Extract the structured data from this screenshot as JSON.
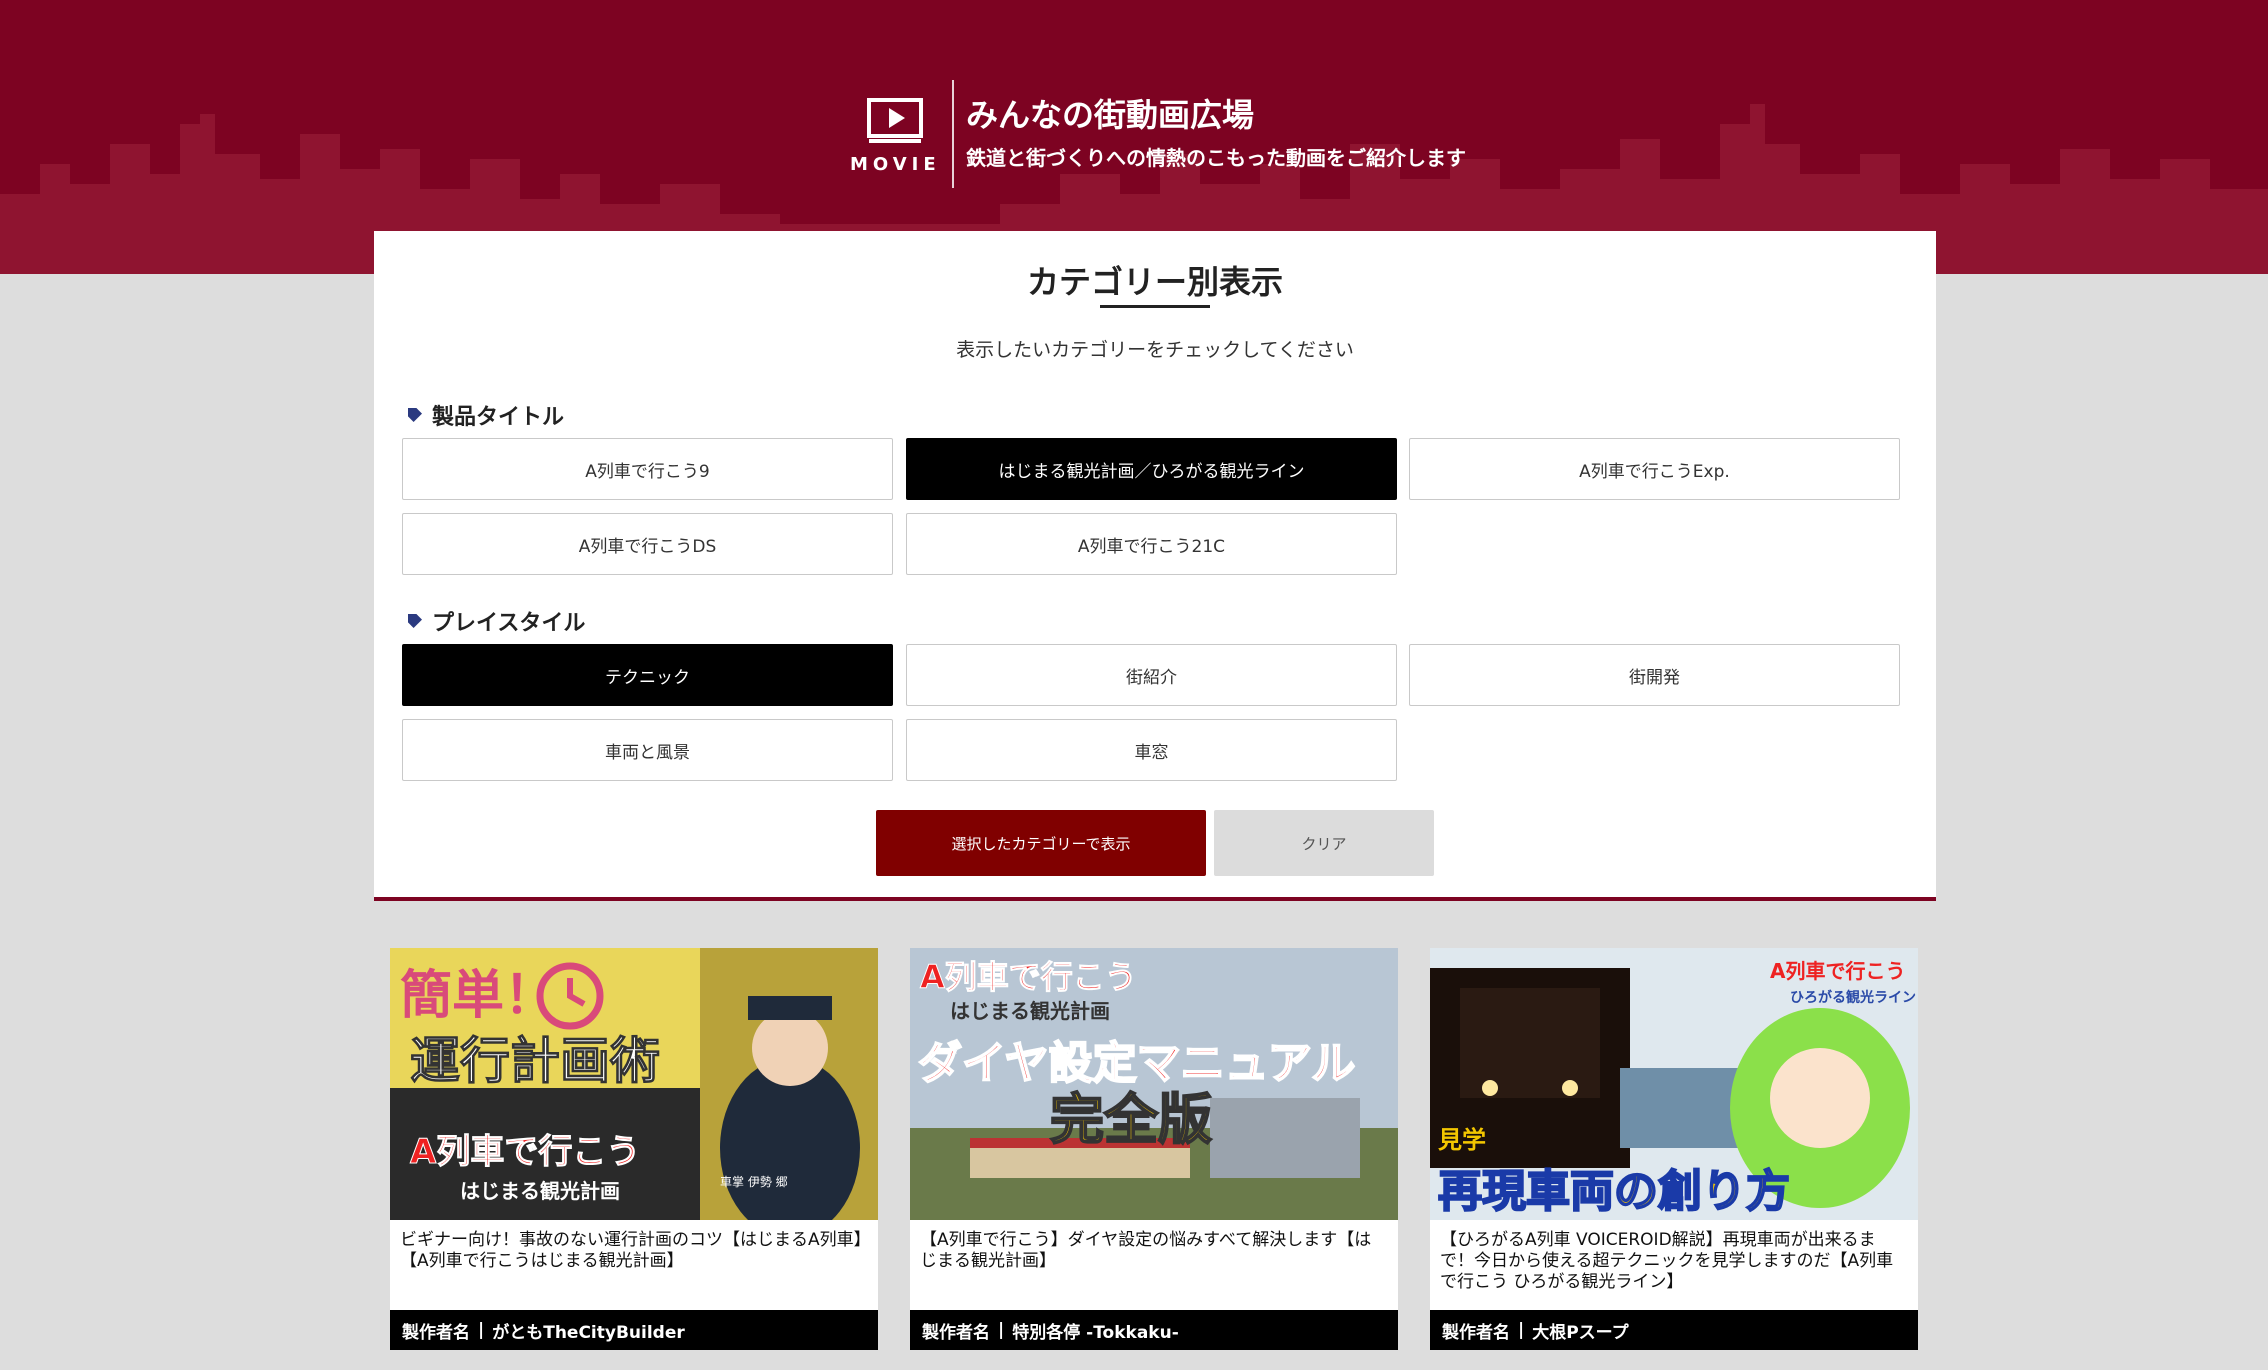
{
  "header": {
    "movie_label": "MOVIE",
    "title": "みんなの街動画広場",
    "subtitle": "鉄道と街づくりへの情熱のこもった動画をご紹介します",
    "icons": [
      "video-play-icon"
    ],
    "colors": {
      "brand": "#7d0322",
      "skyline": "#8f1430"
    }
  },
  "panel": {
    "title": "カテゴリー別表示",
    "subtitle": "表示したいカテゴリーをチェックしてください",
    "sections": [
      {
        "label": "製品タイトル",
        "options": [
          {
            "label": "A列車で行こう9",
            "selected": false
          },
          {
            "label": "はじまる観光計画／ひろがる観光ライン",
            "selected": true
          },
          {
            "label": "A列車で行こうExp.",
            "selected": false
          },
          {
            "label": "A列車で行こうDS",
            "selected": false
          },
          {
            "label": "A列車で行こう21C",
            "selected": false
          }
        ]
      },
      {
        "label": "プレイスタイル",
        "options": [
          {
            "label": "テクニック",
            "selected": true
          },
          {
            "label": "街紹介",
            "selected": false
          },
          {
            "label": "街開発",
            "selected": false
          },
          {
            "label": "車両と風景",
            "selected": false
          },
          {
            "label": "車窓",
            "selected": false
          }
        ]
      }
    ],
    "show_button": "選択したカテゴリーで表示",
    "clear_button": "クリア"
  },
  "cards": [
    {
      "thumb_texts": [
        "簡単！",
        "運行計画術",
        "A列車で行こう",
        "はじまる観光計画",
        "車掌 伊勢 郷"
      ],
      "title": "ビギナー向け！事故のない運行計画のコツ【はじまるA列車】【A列車で行こうはじまる観光計画】",
      "author_label": "製作者名",
      "author": "がともTheCityBuilder"
    },
    {
      "thumb_texts": [
        "A列車で行こう",
        "はじまる観光計画",
        "ダイヤ設定マニュアル",
        "完全版"
      ],
      "title": "【A列車で行こう】ダイヤ設定の悩みすべて解決します【はじまる観光計画】",
      "author_label": "製作者名",
      "author": "特別各停 -Tokkaku-"
    },
    {
      "thumb_texts": [
        "A列車で行こう",
        "ひろがる観光ライン",
        "見学",
        "再現車両の創り方"
      ],
      "title": "【ひろがるA列車 VOICEROID解説】再現車両が出来るまで！今日から使える超テクニックを見学しますのだ【A列車で行こう ひろがる観光ライン】",
      "author_label": "製作者名",
      "author": "大根Pスープ"
    }
  ]
}
